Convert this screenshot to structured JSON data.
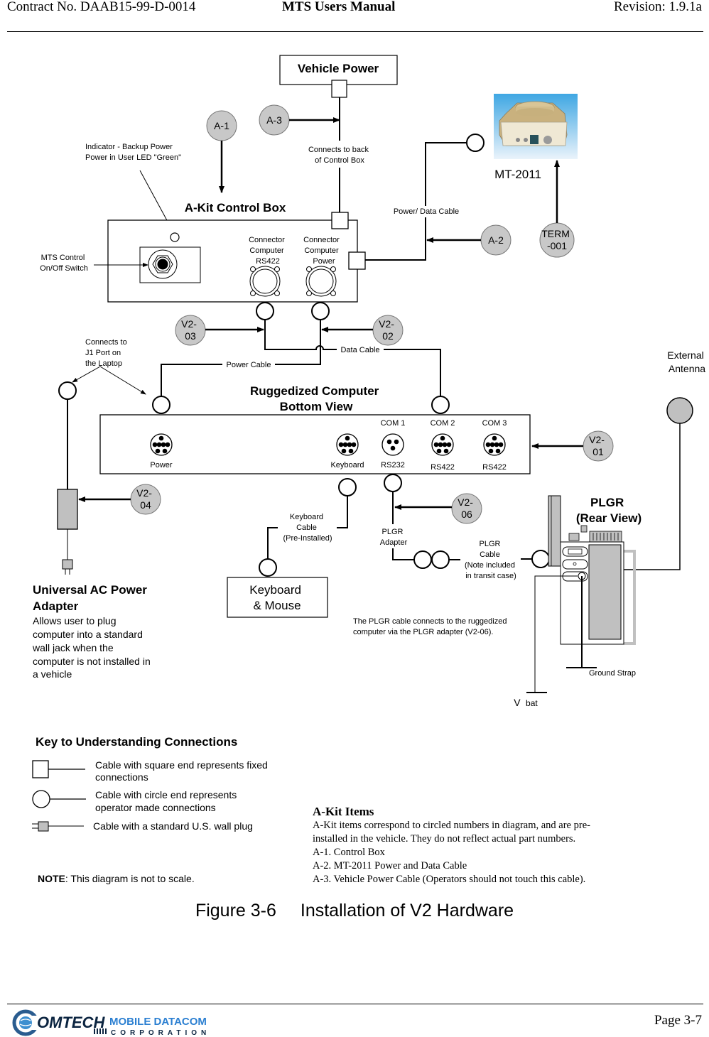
{
  "header": {
    "contract": "Contract No. DAAB15-99-D-0014",
    "manual_title": "MTS Users Manual",
    "revision": "Revision:  1.9.1a"
  },
  "diagram": {
    "vehicle_power": "Vehicle Power",
    "connects_back": [
      "Connects to back",
      "of Control Box"
    ],
    "indicator_note": [
      "Indicator - Backup Power",
      "Power in User LED \"Green\""
    ],
    "control_box_title": "A-Kit Control Box",
    "mts_switch": [
      "MTS Control",
      "On/Off Switch"
    ],
    "conn_rs422": [
      "Connector",
      "Computer",
      "RS422"
    ],
    "conn_power": [
      "Connector",
      "Computer",
      "Power"
    ],
    "power_data_cable": "Power/ Data Cable",
    "mt2011": "MT-2011",
    "data_cable": "Data Cable",
    "power_cable": "Power Cable",
    "connects_j1": [
      "Connects to",
      "J1 Port on",
      "the Laptop"
    ],
    "computer_title": [
      "Ruggedized Computer",
      "Bottom View"
    ],
    "ports": [
      {
        "top": "",
        "bottom": "Power"
      },
      {
        "top": "",
        "bottom": "Keyboard"
      },
      {
        "top": "COM 1",
        "bottom": "RS232"
      },
      {
        "top": "COM 2",
        "bottom": "RS422"
      },
      {
        "top": "COM 3",
        "bottom": "RS422"
      }
    ],
    "external_antenna": [
      "External",
      "Antenna"
    ],
    "keyboard_cable": [
      "Keyboard",
      "Cable",
      "(Pre-Installed)"
    ],
    "keyboard_mouse": [
      "Keyboard",
      "& Mouse"
    ],
    "plgr_adapter": [
      "PLGR",
      "Adapter"
    ],
    "plgr_cable": [
      "PLGR",
      "Cable",
      "(Note included",
      "in transit case)"
    ],
    "plgr_title": [
      "PLGR",
      "(Rear View)"
    ],
    "plgr_note": [
      "The PLGR cable connects to the ruggedized",
      "computer via the PLGR adapter (V2-06)."
    ],
    "ground_strap": "Ground Strap",
    "vbat": [
      "V",
      "bat"
    ],
    "ac_adapter_title": [
      "Universal AC Power",
      "Adapter"
    ],
    "ac_adapter_desc": [
      "Allows user to plug",
      "computer into a standard",
      "wall jack when the",
      "computer is not installed in",
      "a vehicle"
    ],
    "callouts": {
      "a1": "A-1",
      "a2": "A-2",
      "a3": "A-3",
      "term": [
        "TERM",
        "-001"
      ],
      "v201": [
        "V2-",
        "01"
      ],
      "v202": [
        "V2-",
        "02"
      ],
      "v203": [
        "V2-",
        "03"
      ],
      "v204": [
        "V2-",
        "04"
      ],
      "v206": [
        "V2-",
        "06"
      ]
    },
    "key": {
      "title": "Key to Understanding Connections",
      "square": [
        "Cable with square end represents fixed",
        "connections"
      ],
      "circle": [
        "Cable with circle end represents",
        "operator made connections"
      ],
      "plug": "Cable with a standard U.S. wall plug"
    },
    "note_bold": "NOTE",
    "note_text": ": This diagram is not to scale.",
    "colors": {
      "callout_fill": "#c8c8c8",
      "plgr_gray": "#c0c0c0"
    }
  },
  "akit_items": {
    "title": "A-Kit Items",
    "description": "A-Kit items correspond to circled numbers in diagram, and are pre-installed in the vehicle.  They do not reflect actual part numbers.",
    "items": [
      "A-1. Control Box",
      "A-2. MT-2011 Power and Data Cable",
      "A-3. Vehicle Power Cable (Operators should not touch this cable)."
    ]
  },
  "caption": {
    "number": "Figure 3-6",
    "title": "Installation of V2 Hardware"
  },
  "footer": {
    "logo_main": "OMTECH",
    "logo_brand": "MOBILE DATACOM",
    "logo_sub": "CORPORATION",
    "page": "Page 3-7"
  }
}
